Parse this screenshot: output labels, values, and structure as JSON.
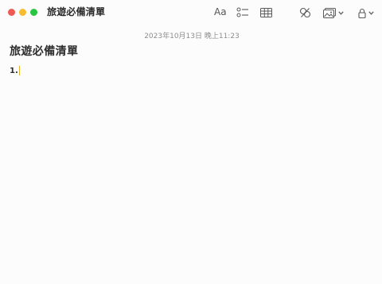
{
  "window": {
    "title": "旅遊必備清單",
    "traffic_lights": {
      "close_color": "#ee5a52",
      "minimize_color": "#f5bd2f",
      "zoom_color": "#28c53f"
    }
  },
  "toolbar": {
    "format_label": "Aa",
    "icons": [
      "format-icon",
      "checklist-icon",
      "table-icon",
      "collaborate-icon",
      "media-icon",
      "lock-icon"
    ]
  },
  "note": {
    "timestamp": "2023年10月13日 晚上11:23",
    "title": "旅遊必備清單",
    "list_item_marker": "1.",
    "cursor_color": "#e8b42a"
  }
}
